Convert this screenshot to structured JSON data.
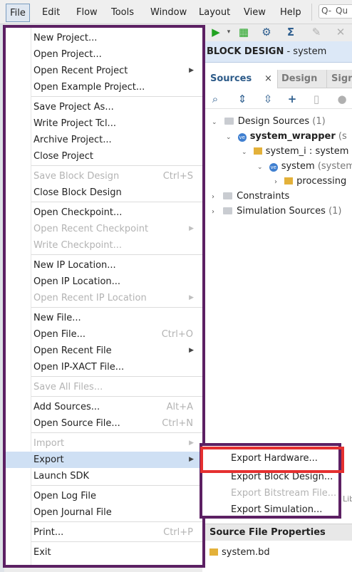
{
  "menubar": {
    "items": [
      "File",
      "Edit",
      "Flow",
      "Tools",
      "Window",
      "Layout",
      "View",
      "Help"
    ],
    "search_prefix": "Q-",
    "search_text": "Qu"
  },
  "block_design": {
    "label": "BLOCK DESIGN",
    "suffix": "- system"
  },
  "sources": {
    "tabs": [
      "Sources",
      "Design",
      "Sign"
    ],
    "close": "×",
    "tree": {
      "design_sources": "Design Sources",
      "design_sources_count": "(1)",
      "system_wrapper": "system_wrapper",
      "system_wrapper_suffix": "(s",
      "system_i": "system_i : system",
      "system": "system",
      "system_suffix": "(system",
      "processing": "processing",
      "constraints": "Constraints",
      "simulation_sources": "Simulation Sources",
      "simulation_sources_count": "(1)"
    },
    "properties_title": "Source File Properties",
    "properties_file": "system.bd",
    "partial_tab": "Lib"
  },
  "file_menu": {
    "items": [
      {
        "label": "New Project...",
        "enabled": true
      },
      {
        "label": "Open Project...",
        "enabled": true
      },
      {
        "label": "Open Recent Project",
        "enabled": true,
        "submenu": true
      },
      {
        "label": "Open Example Project...",
        "enabled": true
      },
      {
        "label": "Save Project As...",
        "enabled": true
      },
      {
        "label": "Write Project Tcl...",
        "enabled": true
      },
      {
        "label": "Archive Project...",
        "enabled": true
      },
      {
        "label": "Close Project",
        "enabled": true
      },
      {
        "label": "Save Block Design",
        "enabled": false,
        "shortcut": "Ctrl+S"
      },
      {
        "label": "Close Block Design",
        "enabled": true
      },
      {
        "label": "Open Checkpoint...",
        "enabled": true
      },
      {
        "label": "Open Recent Checkpoint",
        "enabled": false,
        "submenu": true
      },
      {
        "label": "Write Checkpoint...",
        "enabled": false
      },
      {
        "label": "New IP Location...",
        "enabled": true
      },
      {
        "label": "Open IP Location...",
        "enabled": true
      },
      {
        "label": "Open Recent IP Location",
        "enabled": false,
        "submenu": true
      },
      {
        "label": "New File...",
        "enabled": true
      },
      {
        "label": "Open File...",
        "enabled": true,
        "shortcut": "Ctrl+O"
      },
      {
        "label": "Open Recent File",
        "enabled": true,
        "submenu": true
      },
      {
        "label": "Open IP-XACT File...",
        "enabled": true
      },
      {
        "label": "Save All Files...",
        "enabled": false
      },
      {
        "label": "Add Sources...",
        "enabled": true,
        "shortcut": "Alt+A"
      },
      {
        "label": "Open Source File...",
        "enabled": true,
        "shortcut": "Ctrl+N"
      },
      {
        "label": "Import",
        "enabled": false,
        "submenu": true
      },
      {
        "label": "Export",
        "enabled": true,
        "submenu": true,
        "highlighted": true
      },
      {
        "label": "Launch SDK",
        "enabled": true
      },
      {
        "label": "Open Log File",
        "enabled": true
      },
      {
        "label": "Open Journal File",
        "enabled": true
      },
      {
        "label": "Print...",
        "enabled": true,
        "shortcut": "Ctrl+P"
      },
      {
        "label": "Exit",
        "enabled": true
      }
    ]
  },
  "export_submenu": {
    "items": [
      {
        "label": "Export Hardware...",
        "enabled": true
      },
      {
        "label": "Export Block Design...",
        "enabled": true
      },
      {
        "label": "Export Bitstream File...",
        "enabled": false
      },
      {
        "label": "Export Simulation...",
        "enabled": true
      }
    ]
  },
  "colors": {
    "menu_border": "#5c2063",
    "highlight": "#cfe0f4",
    "annotation_box": "#e53030"
  }
}
